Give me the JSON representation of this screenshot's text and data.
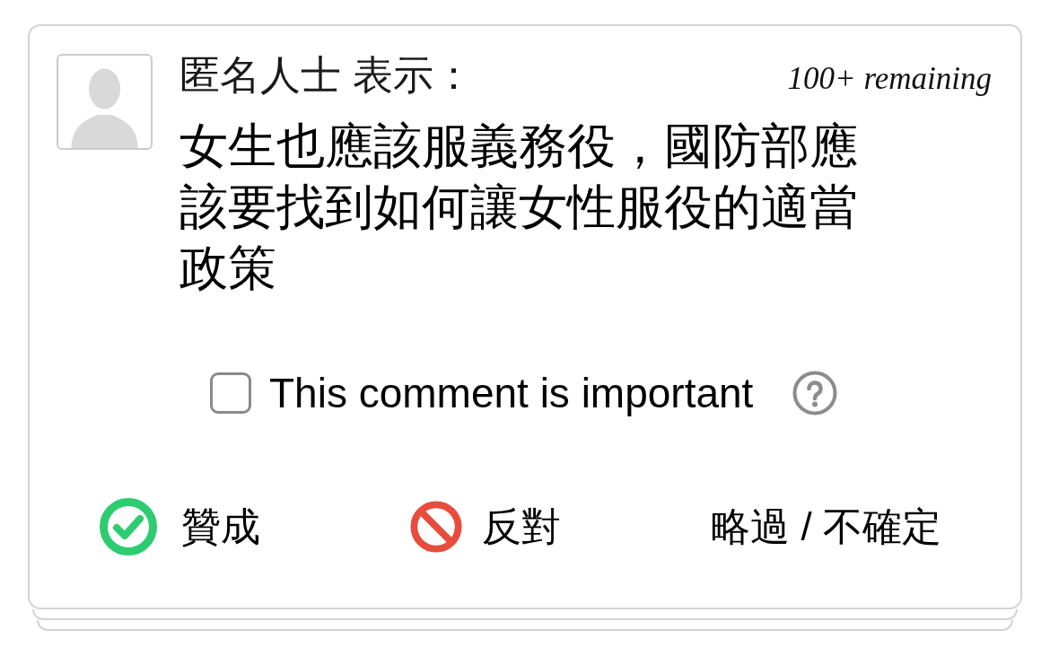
{
  "comment": {
    "author": "匿名人士 表示：",
    "remaining": "100+ remaining",
    "text": "女生也應該服義務役，國防部應該要找到如何讓女性服役的適當政策"
  },
  "important": {
    "label": "This comment is important",
    "checked": false
  },
  "votes": [
    {
      "kind": "agree",
      "label": "贊成"
    },
    {
      "kind": "disagree",
      "label": "反對"
    },
    {
      "kind": "pass",
      "label": "略過 / 不確定"
    }
  ]
}
